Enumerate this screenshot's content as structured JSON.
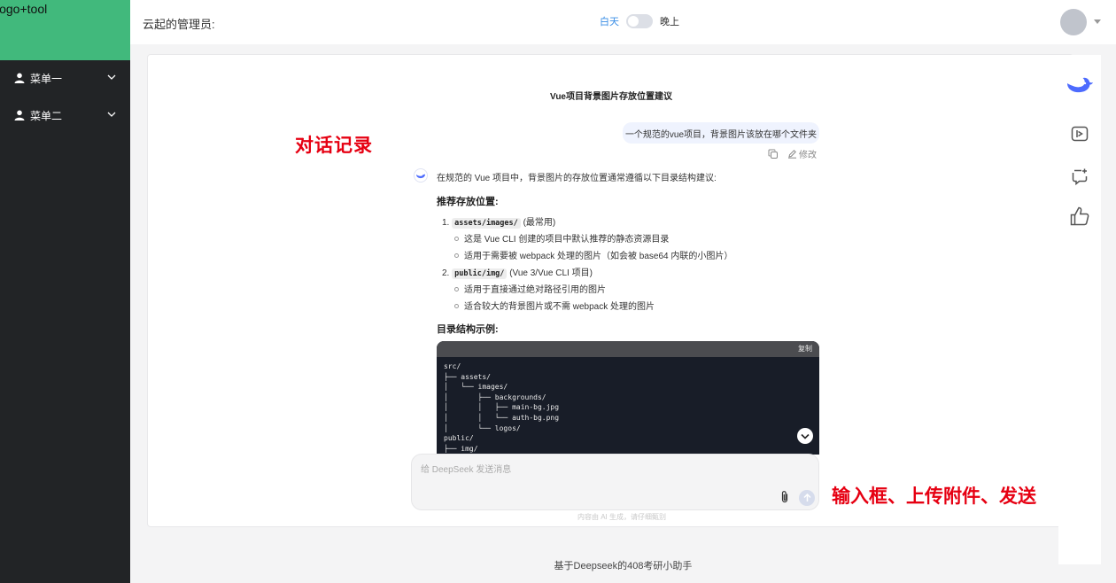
{
  "sidebar": {
    "logo_text": "logo+tool",
    "items": [
      {
        "label": "菜单一"
      },
      {
        "label": "菜单二"
      }
    ]
  },
  "header": {
    "admin_label": "云起的管理员:",
    "theme": {
      "day_label": "白天",
      "night_label": "晚上",
      "night_mode_on": false
    }
  },
  "chat": {
    "title": "Vue项目背景图片存放位置建议",
    "annotation_history": "对话记录",
    "user_message": "一个规范的vue项目，背景图片该放在哪个文件夹",
    "edit_label": "修改",
    "ai_intro": "在规范的 Vue 项目中，背景图片的存放位置通常遵循以下目录结构建议:",
    "section_recommend": "推荐存放位置:",
    "item1": {
      "num": "1.",
      "code": "assets/images/",
      "note": "(最常用)"
    },
    "item1_bullets": [
      "这是 Vue CLI 创建的项目中默认推荐的静态资源目录",
      "适用于需要被 webpack 处理的图片（如会被 base64 内联的小图片）"
    ],
    "item2": {
      "num": "2.",
      "code": "public/img/",
      "note": "(Vue 3/Vue CLI 项目)"
    },
    "item2_bullets": [
      "适用于直接通过绝对路径引用的图片",
      "适合较大的背景图片或不需 webpack 处理的图片"
    ],
    "section_structure": "目录结构示例:",
    "code_copy_label": "复制",
    "code_text": "src/\n├── assets/\n│   └── images/\n│       ├── backgrounds/\n│       │   ├── main-bg.jpg\n│       │   └── auth-bg.png\n│       └── logos/\npublic/\n├── img/"
  },
  "input": {
    "placeholder": "给 DeepSeek 发送消息",
    "annotation": "输入框、上传附件、发送",
    "disclaimer": "内容由 AI 生成，请仔细甄别"
  },
  "footer": {
    "text": "基于Deepseek的408考研小助手"
  },
  "colors": {
    "sidebar_bg": "#222426",
    "logo_bg": "#41b97c",
    "accent": "#4d6bfe",
    "annotation_red": "#e60012"
  },
  "rail_icons": [
    "deepseek-whale-icon",
    "new-chat-icon",
    "feedback-icon",
    "like-icon"
  ]
}
